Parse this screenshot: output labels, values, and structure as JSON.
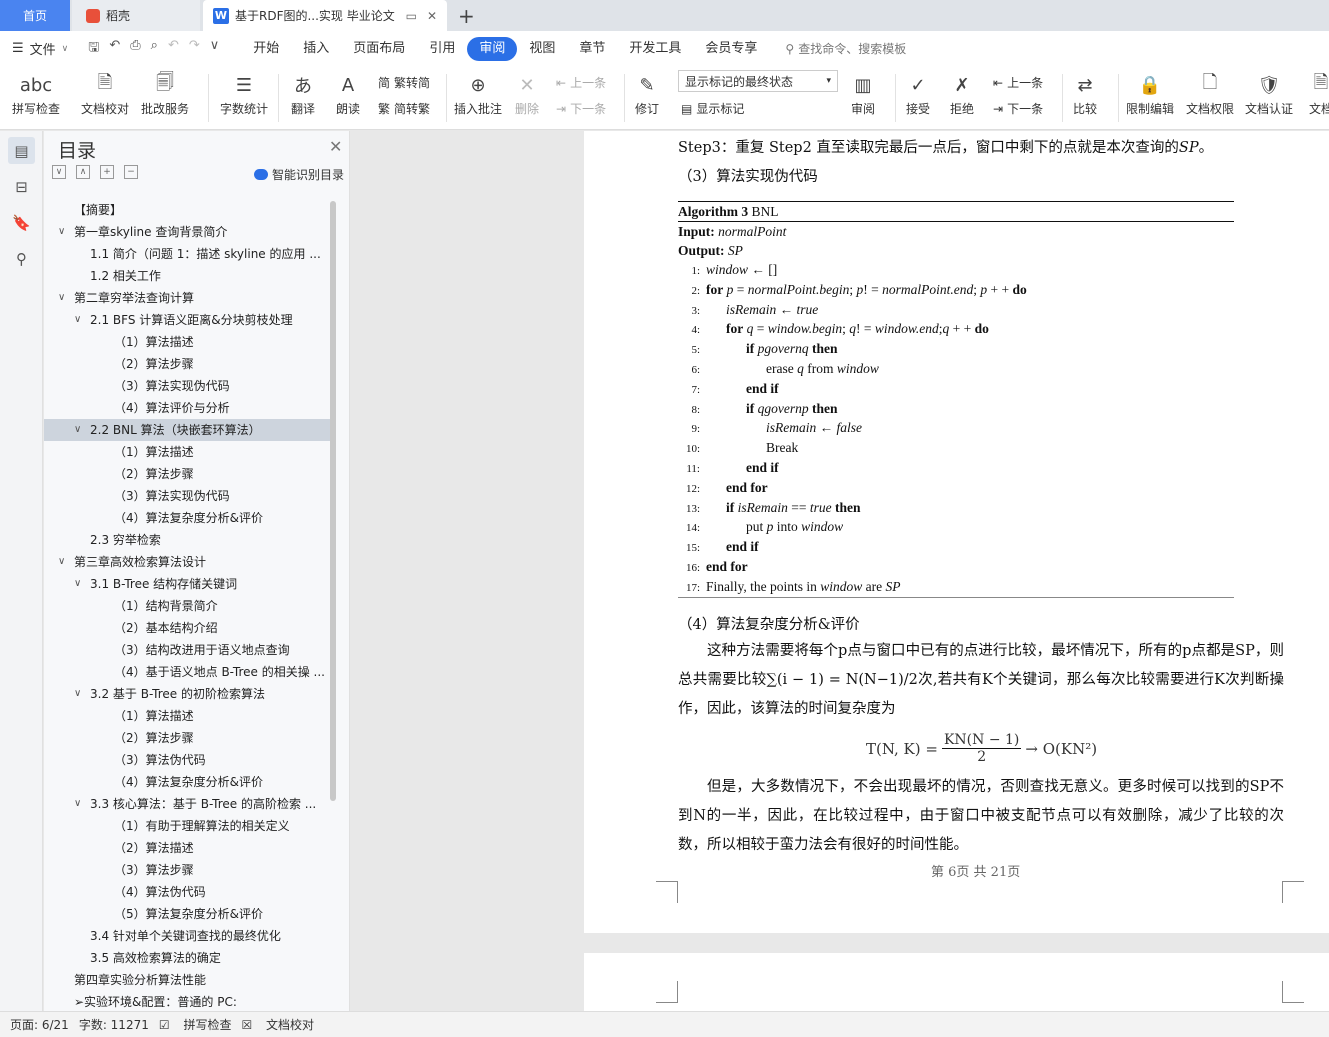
{
  "tabs": {
    "home": "首页",
    "shell": "稻壳",
    "doc": "基于RDF图的...实现 毕业论文"
  },
  "menu": {
    "file": "文件",
    "items": [
      "开始",
      "插入",
      "页面布局",
      "引用",
      "审阅",
      "视图",
      "章节",
      "开发工具",
      "会员专享"
    ],
    "active": "审阅",
    "search": "查找命令、搜索模板"
  },
  "ribbon": {
    "spell": "拼写检查",
    "doc_check": "文档校对",
    "annotate_service": "批改服务",
    "word_count": "字数统计",
    "translate": "翻译",
    "read": "朗读",
    "trad": "繁转简",
    "simp": "简转繁",
    "insert_comment": "插入批注",
    "delete": "删除",
    "prev": "上一条",
    "next": "下一条",
    "revise": "修订",
    "markup_state": "显示标记的最终状态",
    "show_markup": "显示标记",
    "review": "审阅",
    "accept": "接受",
    "reject": "拒绝",
    "prev2": "上一条",
    "next2": "下一条",
    "compare": "比较",
    "restrict": "限制编辑",
    "permission": "文档权限",
    "certify": "文档认证",
    "last": "文档"
  },
  "toc": {
    "title": "目录",
    "smart": "智能识别目录",
    "items": [
      {
        "level": 0,
        "text": "【摘要】",
        "chev": ""
      },
      {
        "level": 0,
        "text": "第一章skyline 查询背景简介",
        "chev": "v"
      },
      {
        "level": 1,
        "text": "1.1  简介（问题 1：描述 skyline 的应用 ...",
        "chev": ""
      },
      {
        "level": 1,
        "text": "1.2  相关工作",
        "chev": ""
      },
      {
        "level": 0,
        "text": "第二章穷举法查询计算",
        "chev": "v"
      },
      {
        "level": 1,
        "text": "2.1 BFS 计算语义距离&分块剪枝处理",
        "chev": "v"
      },
      {
        "level": 2,
        "text": "（1）算法描述",
        "chev": ""
      },
      {
        "level": 2,
        "text": "（2）算法步骤",
        "chev": ""
      },
      {
        "level": 2,
        "text": "（3）算法实现伪代码",
        "chev": ""
      },
      {
        "level": 2,
        "text": "（4）算法评价与分析",
        "chev": ""
      },
      {
        "level": 1,
        "text": "2.2 BNL 算法（块嵌套环算法）",
        "chev": "v",
        "selected": true
      },
      {
        "level": 2,
        "text": "（1）算法描述",
        "chev": ""
      },
      {
        "level": 2,
        "text": "（2）算法步骤",
        "chev": ""
      },
      {
        "level": 2,
        "text": "（3）算法实现伪代码",
        "chev": ""
      },
      {
        "level": 2,
        "text": "（4）算法复杂度分析&评价",
        "chev": ""
      },
      {
        "level": 1,
        "text": "2.3 穷举检索",
        "chev": ""
      },
      {
        "level": 0,
        "text": "第三章高效检索算法设计",
        "chev": "v"
      },
      {
        "level": 1,
        "text": "3.1 B-Tree 结构存储关键词",
        "chev": "v"
      },
      {
        "level": 2,
        "text": "（1）结构背景简介",
        "chev": ""
      },
      {
        "level": 2,
        "text": "（2）基本结构介绍",
        "chev": ""
      },
      {
        "level": 2,
        "text": "（3）结构改进用于语义地点查询",
        "chev": ""
      },
      {
        "level": 2,
        "text": "（4）基于语义地点 B-Tree 的相关操 ...",
        "chev": ""
      },
      {
        "level": 1,
        "text": "3.2  基于 B-Tree 的初阶检索算法",
        "chev": "v"
      },
      {
        "level": 2,
        "text": "（1）算法描述",
        "chev": ""
      },
      {
        "level": 2,
        "text": "（2）算法步骤",
        "chev": ""
      },
      {
        "level": 2,
        "text": "（3）算法伪代码",
        "chev": ""
      },
      {
        "level": 2,
        "text": "（4）算法复杂度分析&评价",
        "chev": ""
      },
      {
        "level": 1,
        "text": "3.3  核心算法：基于 B-Tree 的高阶检索 ...",
        "chev": "v"
      },
      {
        "level": 2,
        "text": "（1）有助于理解算法的相关定义",
        "chev": ""
      },
      {
        "level": 2,
        "text": "（2）算法描述",
        "chev": ""
      },
      {
        "level": 2,
        "text": "（3）算法步骤",
        "chev": ""
      },
      {
        "level": 2,
        "text": "（4）算法伪代码",
        "chev": ""
      },
      {
        "level": 2,
        "text": "（5）算法复杂度分析&评价",
        "chev": ""
      },
      {
        "level": 1,
        "text": "3.4  针对单个关键词查找的最终优化",
        "chev": ""
      },
      {
        "level": 1,
        "text": "3.5  高效检索算法的确定",
        "chev": ""
      },
      {
        "level": 0,
        "text": "第四章实验分析算法性能",
        "chev": ""
      },
      {
        "level": 0,
        "text": "➢实验环境&配置：普通的 PC:",
        "chev": ""
      }
    ]
  },
  "document": {
    "step3": "Step3：重复 Step2 直至读取完最后一点后，窗口中剩下的点就是本次查询的",
    "step3_sp": "SP",
    "step3_end": "。",
    "section3": "（3）算法实现伪代码",
    "algo_title_bold": "Algorithm 3",
    "algo_title": " BNL",
    "input_label": "Input:",
    "input_val": "normalPoint",
    "output_label": "Output:",
    "output_val": "SP",
    "lines": [
      {
        "n": "1:",
        "indent": 0,
        "html": "<span class='it'>window</span> ← []"
      },
      {
        "n": "2:",
        "indent": 0,
        "html": "<span class='b'>for</span> <span class='it'>p</span> = <span class='it'>normalPoint.begin</span>; <span class='it'>p</span>! = <span class='it'>normalPoint.end</span>; <span class='it'>p</span> + +  <span class='b'>do</span>"
      },
      {
        "n": "3:",
        "indent": 1,
        "html": "<span class='it'>isRemain</span> ← <span class='it'>true</span>"
      },
      {
        "n": "4:",
        "indent": 1,
        "html": "<span class='b'>for</span> <span class='it'>q</span> = <span class='it'>window.begin</span>; <span class='it'>q</span>! = <span class='it'>window.end</span>;<span class='it'>q</span> + +  <span class='b'>do</span>"
      },
      {
        "n": "5:",
        "indent": 2,
        "html": "<span class='b'>if</span> <span class='it'>pgovernq</span> <span class='b'>then</span>"
      },
      {
        "n": "6:",
        "indent": 3,
        "html": "erase <span class='it'>q</span> from <span class='it'>window</span>"
      },
      {
        "n": "7:",
        "indent": 2,
        "html": "<span class='b'>end if</span>"
      },
      {
        "n": "8:",
        "indent": 2,
        "html": "<span class='b'>if</span> <span class='it'>qgovernp</span> <span class='b'>then</span>"
      },
      {
        "n": "9:",
        "indent": 3,
        "html": "<span class='it'>isRemain</span> ← <span class='it'>false</span>"
      },
      {
        "n": "10:",
        "indent": 3,
        "html": "Break"
      },
      {
        "n": "11:",
        "indent": 2,
        "html": "<span class='b'>end if</span>"
      },
      {
        "n": "12:",
        "indent": 1,
        "html": "<span class='b'>end for</span>"
      },
      {
        "n": "13:",
        "indent": 1,
        "html": "<span class='b'>if</span> <span class='it'>isRemain</span> == <span class='it'>true</span> <span class='b'>then</span>"
      },
      {
        "n": "14:",
        "indent": 2,
        "html": "put <span class='it'>p</span> into <span class='it'>window</span>"
      },
      {
        "n": "15:",
        "indent": 1,
        "html": "<span class='b'>end if</span>"
      },
      {
        "n": "16:",
        "indent": 0,
        "html": "<span class='b'>end for</span>"
      },
      {
        "n": "17:",
        "indent": 0,
        "html": "Finally, the points in <span class='it'>window</span> are <span class='it'>SP</span>"
      }
    ],
    "section4": "（4）算法复杂度分析&评价",
    "para1": "这种方法需要将每个p点与窗口中已有的点进行比较，最坏情况下，所有的p点都是SP，则总共需要比较∑(i − 1) = N(N−1)/2次,若共有K个关键词，那么每次比较需要进行K次判断操作，因此，该算法的时间复杂度为",
    "formula_left": "T(N, K) =",
    "formula_num": "KN(N − 1)",
    "formula_den": "2",
    "formula_right": "→ O(KN²)",
    "para2": "但是，大多数情况下，不会出现最坏的情况，否则查找无意义。更多时候可以找到的SP不到N的一半，因此，在比较过程中，由于窗口中被支配节点可以有效删除，减少了比较的次数，所以相较于蛮力法会有很好的时间性能。",
    "page_footer": "第 6页   共 21页"
  },
  "status": {
    "page": "页面: 6/21",
    "words": "字数: 11271",
    "spell": "拼写检查",
    "check": "文档校对"
  },
  "colors": {
    "accent": "#2b6fe6",
    "selected_toc": "#cdd4dd"
  }
}
